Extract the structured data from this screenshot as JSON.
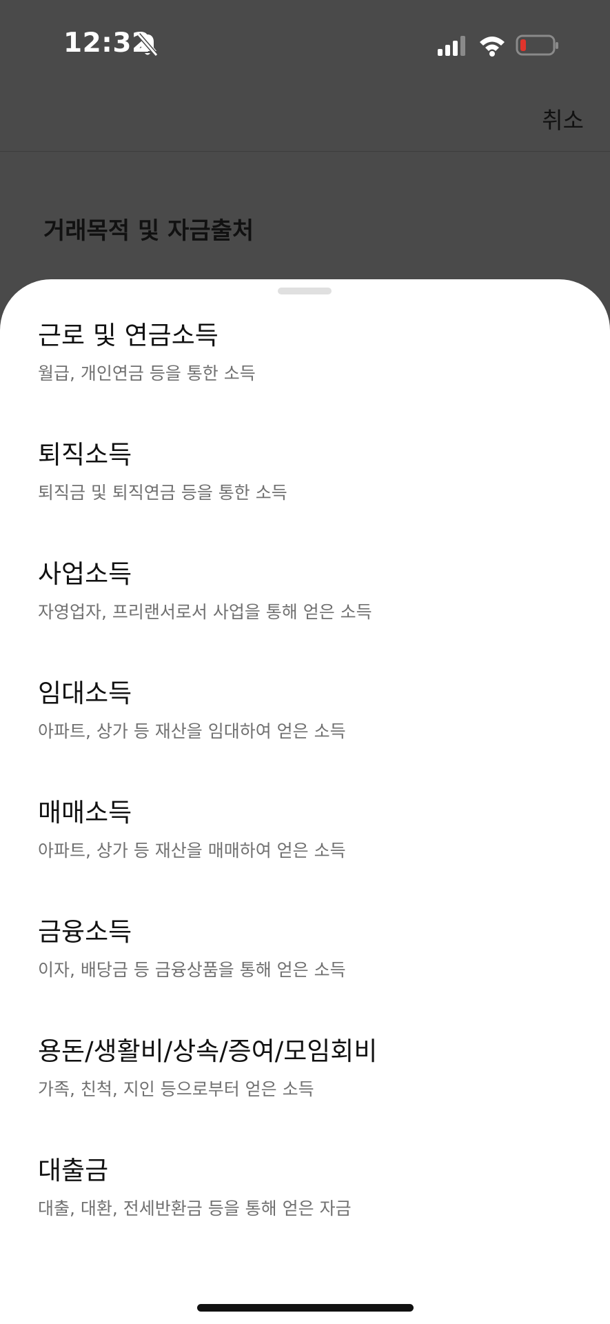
{
  "status_bar": {
    "time": "12:32",
    "icons": [
      "bell-slash-icon",
      "cellular-signal-icon",
      "wifi-icon",
      "battery-low-icon"
    ],
    "battery_color": "#e0342c"
  },
  "header": {
    "cancel_label": "취소",
    "title": "거래목적 및 자금출처"
  },
  "sheet": {
    "options": [
      {
        "title": "근로 및 연금소득",
        "description": "월급, 개인연금 등을 통한 소득"
      },
      {
        "title": "퇴직소득",
        "description": "퇴직금 및 퇴직연금 등을 통한 소득"
      },
      {
        "title": "사업소득",
        "description": "자영업자, 프리랜서로서 사업을 통해 얻은 소득"
      },
      {
        "title": "임대소득",
        "description": "아파트, 상가 등 재산을 임대하여 얻은 소득"
      },
      {
        "title": "매매소득",
        "description": "아파트, 상가 등 재산을 매매하여 얻은 소득"
      },
      {
        "title": "금융소득",
        "description": "이자, 배당금 등 금융상품을 통해 얻은 소득"
      },
      {
        "title": "용돈/생활비/상속/증여/모임회비",
        "description": "가족, 친척, 지인 등으로부터 얻은 소득"
      },
      {
        "title": "대출금",
        "description": "대출, 대환, 전세반환금 등을 통해 얻은 자금"
      }
    ]
  }
}
